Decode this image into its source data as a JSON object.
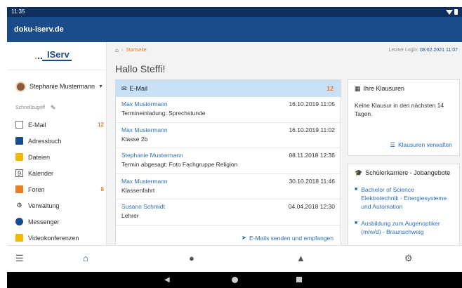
{
  "statusbar": {
    "time": "11:35"
  },
  "app": {
    "title": "doku-iserv.de"
  },
  "sidebar": {
    "logo": "IServ",
    "user": "Stephanie Mustermann",
    "quick_access": "Schnellzugriff",
    "items": [
      {
        "label": "E-Mail",
        "count": "12",
        "icon": "mail-icon"
      },
      {
        "label": "Adressbuch",
        "count": "",
        "icon": "addressbook-icon"
      },
      {
        "label": "Dateien",
        "count": "",
        "icon": "folder-icon"
      },
      {
        "label": "Kalender",
        "count": "",
        "icon": "calendar-icon"
      },
      {
        "label": "Foren",
        "count": "8",
        "icon": "forum-icon"
      },
      {
        "label": "Verwaltung",
        "count": "",
        "icon": "gear-icon"
      },
      {
        "label": "Messenger",
        "count": "",
        "icon": "messenger-icon"
      },
      {
        "label": "Videokonferenzen",
        "count": "",
        "icon": "video-icon"
      }
    ]
  },
  "breadcrumb": {
    "current": "Startseite"
  },
  "last_login": {
    "label": "Letzter Login:",
    "date": "08.02.2021 11:07"
  },
  "greeting": "Hallo Steffi!",
  "mail": {
    "title": "E-Mail",
    "count": "12",
    "messages": [
      {
        "sender": "Max Mustermann",
        "date": "16.10.2019 11:05",
        "subject": "Termineinladung: Sprechstunde"
      },
      {
        "sender": "Max Mustermann",
        "date": "16.10.2019 11:02",
        "subject": "Klasse 2b"
      },
      {
        "sender": "Stephanie Mustermann",
        "date": "08.11.2018 12:36",
        "subject": "Termin abgesagt: Foto Fachgruppe Religion"
      },
      {
        "sender": "Max Mustermann",
        "date": "30.10.2018 11:46",
        "subject": "Klassenfahrt"
      },
      {
        "sender": "Susann Schmidt",
        "date": "04.04.2018 12:30",
        "subject": "Lehrer"
      }
    ],
    "footer_link": "E-Mails senden und empfangen"
  },
  "exams": {
    "title": "Ihre Klausuren",
    "message": "Keine Klausur in den nächsten 14 Tagen.",
    "link": "Klausuren verwalten"
  },
  "career": {
    "title": "Schülerkarriere - Jobangebote",
    "jobs": [
      "Bachelor of Science Elektrotechnik - Energiesysteme und Automation",
      "Ausbildung zum Augenoptiker (m/w/d) - Braunschweig"
    ]
  },
  "bottom_nav": [
    "menu-icon",
    "home-icon",
    "chat-icon",
    "bell-icon",
    "gear-icon"
  ],
  "colors": {
    "appbar": "#1a4c8b",
    "statusbar": "#0f2f5f",
    "accent": "#e67e22",
    "link": "#2c6fb7",
    "mail_header": "#c9e1f7"
  }
}
